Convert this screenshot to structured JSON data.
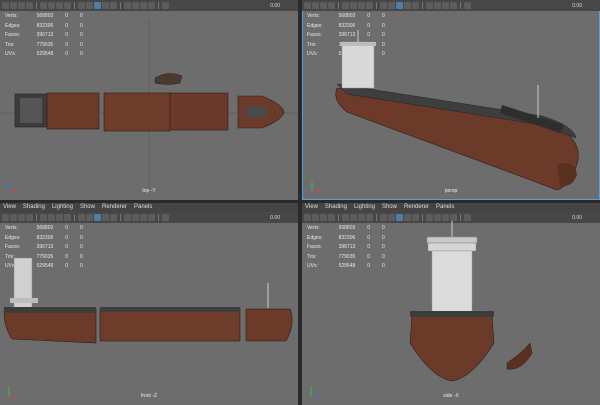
{
  "menu": [
    "View",
    "Shading",
    "Lighting",
    "Show",
    "Renderer",
    "Panels"
  ],
  "toolbar": {
    "value": "0.00"
  },
  "stats": {
    "rows": [
      {
        "label": "Verts:",
        "a": "568803",
        "b": "0",
        "c": "0"
      },
      {
        "label": "Edges:",
        "a": "832306",
        "b": "0",
        "c": "0"
      },
      {
        "label": "Faces:",
        "a": "396713",
        "b": "0",
        "c": "0"
      },
      {
        "label": "Tris:",
        "a": "779035",
        "b": "0",
        "c": "0"
      },
      {
        "label": "UVs:",
        "a": "529548",
        "b": "0",
        "c": "0"
      }
    ]
  },
  "viewports": {
    "top": {
      "camera": "top -Y"
    },
    "persp": {
      "camera": "persp"
    },
    "front": {
      "camera": "front -Z"
    },
    "side": {
      "camera": "side -X"
    }
  },
  "colors": {
    "viewport_bg": "#6d6d6d",
    "hull_rust": "#6b3a28",
    "deck": "#3b3b3b",
    "tower": "#d9d9d9",
    "active_icon": "#4d7da8",
    "axis_x": "#e04040",
    "axis_y": "#40c040",
    "axis_z": "#4070e0"
  }
}
